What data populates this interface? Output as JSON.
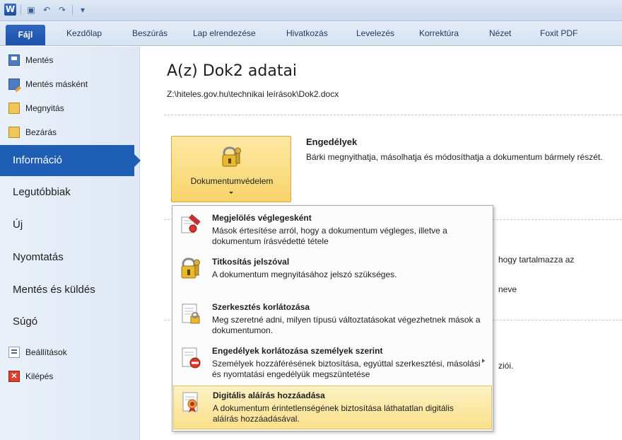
{
  "qat": {
    "logo": "W",
    "buttons": [
      "save-icon",
      "undo-icon",
      "redo-icon",
      "customize-icon"
    ]
  },
  "ribbon": {
    "file_tab": "Fájl",
    "tabs": [
      "Kezdőlap",
      "Beszúrás",
      "Lap elrendezése",
      "Hivatkozás",
      "Levelezés",
      "Korrektúra",
      "Nézet",
      "Foxit PDF"
    ]
  },
  "nav": {
    "save": "Mentés",
    "save_as": "Mentés másként",
    "open": "Megnyitás",
    "close": "Bezárás",
    "info": "Információ",
    "recent": "Legutóbbiak",
    "new": "Új",
    "print": "Nyomtatás",
    "save_send": "Mentés és küldés",
    "help": "Súgó",
    "options": "Beállítások",
    "exit": "Kilépés"
  },
  "info": {
    "title": "A(z) Dok2 adatai",
    "path": "Z:\\hiteles.gov.hu\\technikai leírások\\Dok2.docx",
    "protect_button": "Dokumentumvédelem",
    "permissions_title": "Engedélyek",
    "permissions_desc": "Bárki megnyithatja, másolhatja és módosíthatja a dokumentum bármely részét.",
    "bg_text_1": "hogy tartalmazza az",
    "bg_text_2": "neve",
    "bg_text_3": "ziói."
  },
  "menu": {
    "items": [
      {
        "title": "Megjelölés véglegesként",
        "desc": "Mások értesítése arról, hogy a dokumentum végleges, illetve a dokumentum írásvédetté tétele",
        "icon": "mark-final-icon"
      },
      {
        "title": "Titkosítás jelszóval",
        "desc": "A dokumentum megnyitásához jelszó szükséges.",
        "icon": "encrypt-lock-icon"
      },
      {
        "title": "Szerkesztés korlátozása",
        "desc": "Meg szeretné adni, milyen típusú változtatásokat végezhetnek mások a dokumentumon.",
        "icon": "restrict-editing-icon"
      },
      {
        "title": "Engedélyek korlátozása személyek szerint",
        "desc": "Személyek hozzáférésének biztosítása, egyúttal szerkesztési, másolási és nyomtatási engedélyük megszüntetése",
        "icon": "restrict-permission-icon"
      },
      {
        "title": "Digitális aláírás hozzáadása",
        "desc": "A dokumentum érintetlenségének biztosítása láthatatlan digitális aláírás hozzáadásával.",
        "icon": "digital-signature-icon"
      }
    ]
  },
  "colors": {
    "accent": "#1e5eb4",
    "highlight": "#fbe08c"
  }
}
